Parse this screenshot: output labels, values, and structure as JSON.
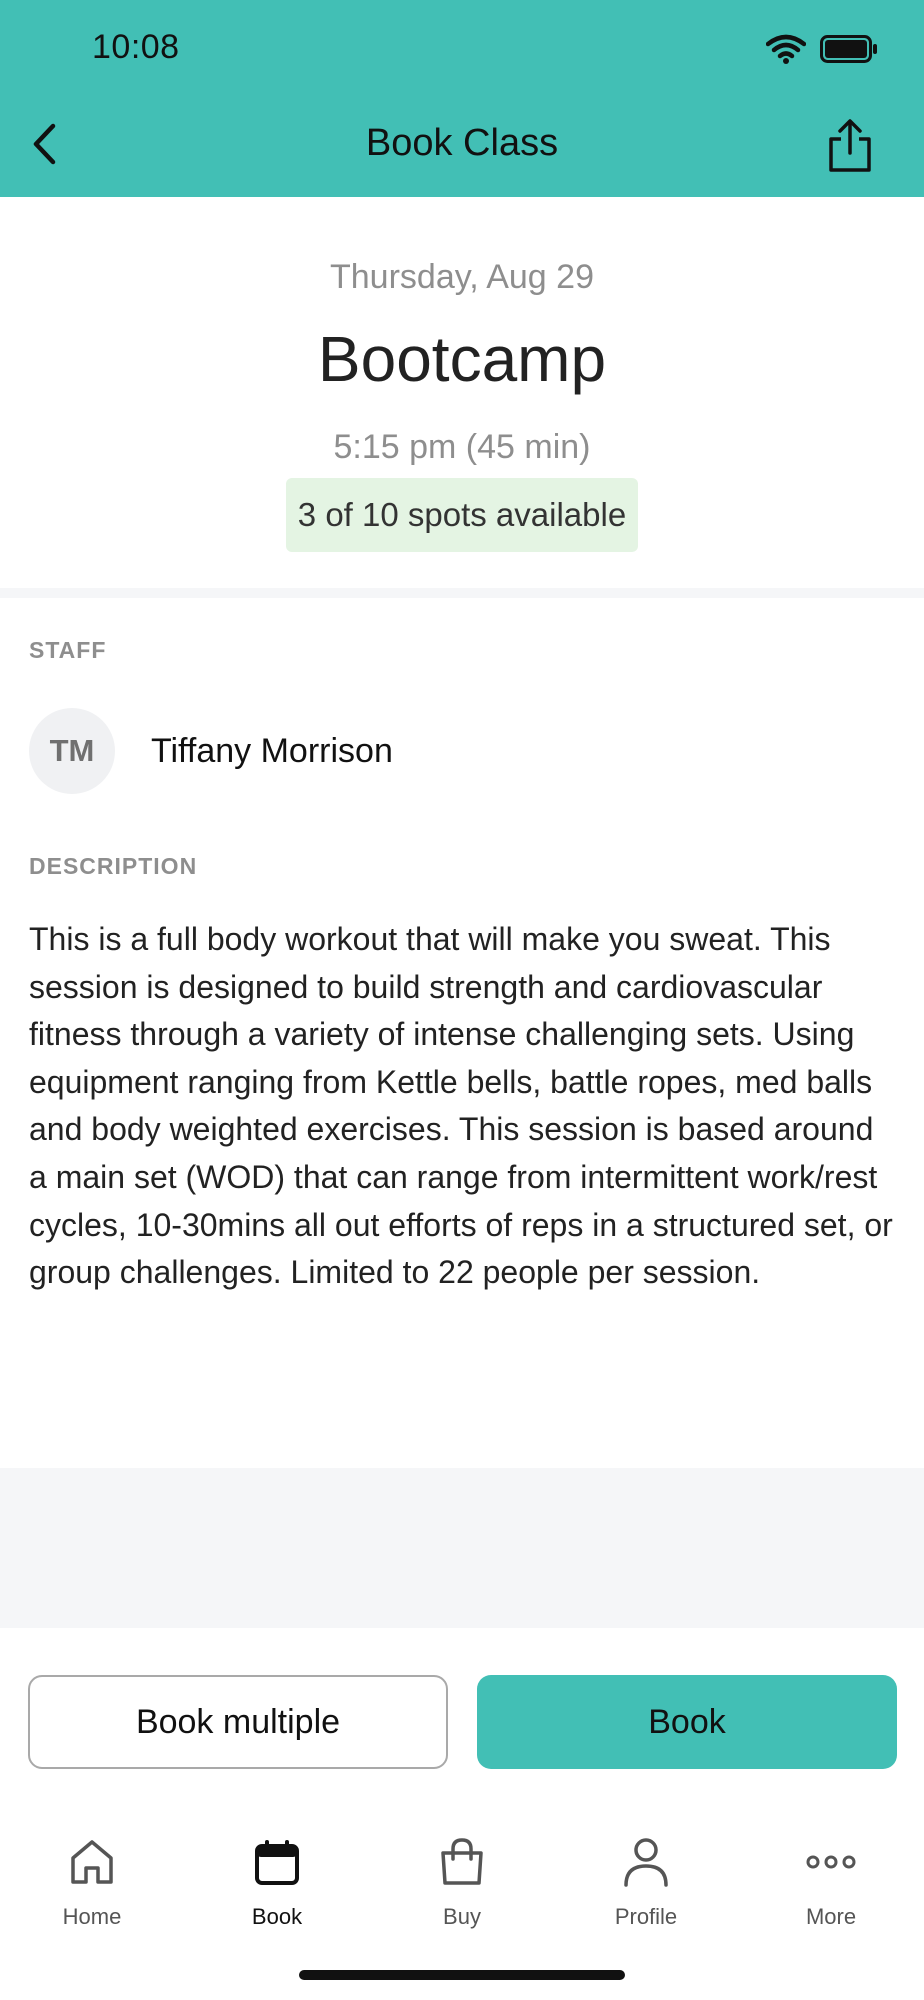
{
  "status_bar": {
    "time": "10:08"
  },
  "header": {
    "title": "Book Class",
    "back_icon": "chevron-left-icon",
    "share_icon": "share-icon",
    "background_color": "#42bfb5"
  },
  "class_info": {
    "date": "Thursday, Aug 29",
    "name": "Bootcamp",
    "time": "5:15 pm (45 min)",
    "spots": "3 of 10 spots available",
    "spots_badge_color": "#e4f4e3"
  },
  "staff": {
    "section_label": "STAFF",
    "initials": "TM",
    "name": "Tiffany Morrison"
  },
  "description": {
    "section_label": "DESCRIPTION",
    "text": "This is a full body workout that will make you sweat. This session is designed to build strength and cardiovascular fitness through a variety of intense challenging sets. Using equipment ranging from Kettle bells, battle ropes, med balls and body weighted exercises. This session is based around a main set (WOD) that can range from intermittent work/rest cycles, 10-30mins all out efforts of reps in a structured set, or group challenges. Limited to 22 people per session."
  },
  "actions": {
    "book_multiple_label": "Book multiple",
    "book_label": "Book",
    "accent_color": "#42bfb5"
  },
  "tab_bar": {
    "items": [
      {
        "label": "Home",
        "icon": "home-icon",
        "active": false
      },
      {
        "label": "Book",
        "icon": "calendar-icon",
        "active": true
      },
      {
        "label": "Buy",
        "icon": "shopping-bag-icon",
        "active": false
      },
      {
        "label": "Profile",
        "icon": "person-icon",
        "active": false
      },
      {
        "label": "More",
        "icon": "more-dots-icon",
        "active": false
      }
    ]
  }
}
